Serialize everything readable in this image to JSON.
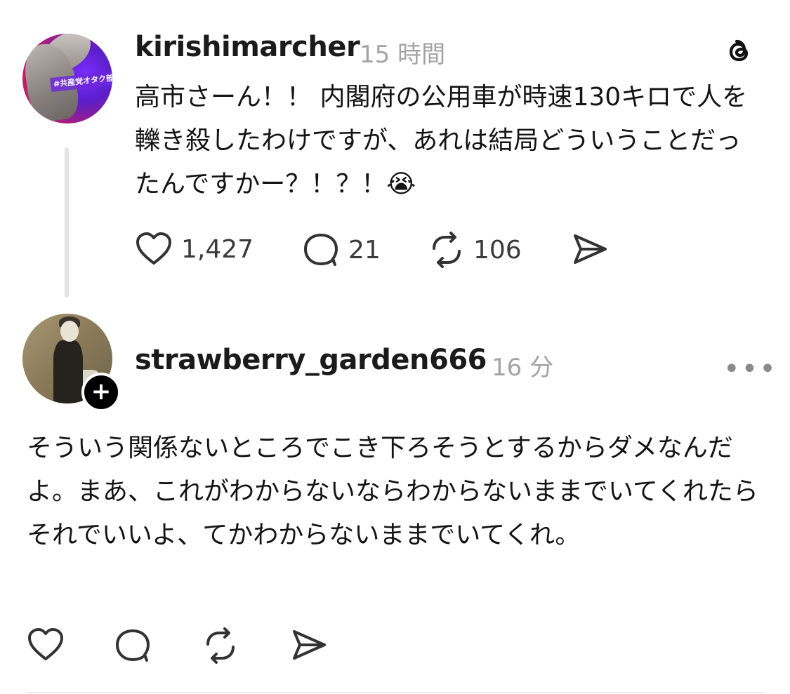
{
  "post": {
    "username": "kirishimarcher",
    "time": "15 時間",
    "avatar_tag": "#共産党オタク部",
    "body": "高市さーん！！ 内閣府の公用車が時速130キロで人を轢き殺したわけですが、あれは結局どういうことだったんですかー？！？！😭",
    "likes": "1,427",
    "replies": "21",
    "reposts": "106",
    "icons": [
      "threads-logo-icon",
      "heart-icon",
      "comment-icon",
      "repost-icon",
      "share-icon"
    ]
  },
  "reply": {
    "username": "strawberry_garden666",
    "time": "16 分",
    "follow_symbol": "+",
    "more_symbol": "•••",
    "body": "そういう関係ないところでこき下ろそうとするからダメなんだよ。まあ、これがわからないならわからないままでいてくれたらそれでいいよ、てかわからないままでいてくれ。",
    "icons": [
      "heart-icon",
      "comment-icon",
      "repost-icon",
      "share-icon",
      "more-icon"
    ]
  },
  "colors": {
    "text": "#141414",
    "muted": "#a3a3a3",
    "icon": "#3a3a3a",
    "thread_line": "#e3e3e3"
  }
}
